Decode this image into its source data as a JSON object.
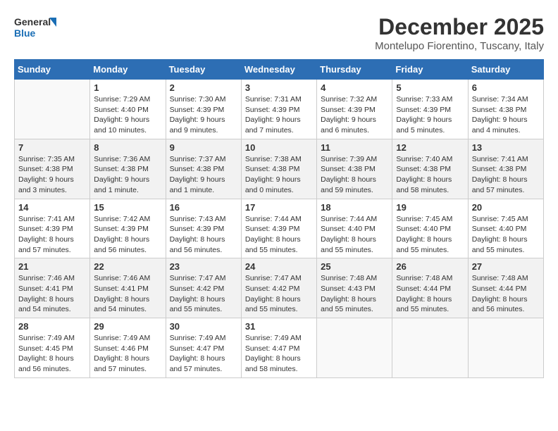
{
  "logo": {
    "line1": "General",
    "line2": "Blue"
  },
  "title": "December 2025",
  "location": "Montelupo Fiorentino, Tuscany, Italy",
  "weekdays": [
    "Sunday",
    "Monday",
    "Tuesday",
    "Wednesday",
    "Thursday",
    "Friday",
    "Saturday"
  ],
  "weeks": [
    [
      {
        "day": "",
        "empty": true
      },
      {
        "day": "1",
        "sunrise": "7:29 AM",
        "sunset": "4:40 PM",
        "daylight": "9 hours and 10 minutes."
      },
      {
        "day": "2",
        "sunrise": "7:30 AM",
        "sunset": "4:39 PM",
        "daylight": "9 hours and 9 minutes."
      },
      {
        "day": "3",
        "sunrise": "7:31 AM",
        "sunset": "4:39 PM",
        "daylight": "9 hours and 7 minutes."
      },
      {
        "day": "4",
        "sunrise": "7:32 AM",
        "sunset": "4:39 PM",
        "daylight": "9 hours and 6 minutes."
      },
      {
        "day": "5",
        "sunrise": "7:33 AM",
        "sunset": "4:39 PM",
        "daylight": "9 hours and 5 minutes."
      },
      {
        "day": "6",
        "sunrise": "7:34 AM",
        "sunset": "4:38 PM",
        "daylight": "9 hours and 4 minutes."
      }
    ],
    [
      {
        "day": "7",
        "sunrise": "7:35 AM",
        "sunset": "4:38 PM",
        "daylight": "9 hours and 3 minutes."
      },
      {
        "day": "8",
        "sunrise": "7:36 AM",
        "sunset": "4:38 PM",
        "daylight": "9 hours and 1 minute."
      },
      {
        "day": "9",
        "sunrise": "7:37 AM",
        "sunset": "4:38 PM",
        "daylight": "9 hours and 1 minute."
      },
      {
        "day": "10",
        "sunrise": "7:38 AM",
        "sunset": "4:38 PM",
        "daylight": "9 hours and 0 minutes."
      },
      {
        "day": "11",
        "sunrise": "7:39 AM",
        "sunset": "4:38 PM",
        "daylight": "8 hours and 59 minutes."
      },
      {
        "day": "12",
        "sunrise": "7:40 AM",
        "sunset": "4:38 PM",
        "daylight": "8 hours and 58 minutes."
      },
      {
        "day": "13",
        "sunrise": "7:41 AM",
        "sunset": "4:38 PM",
        "daylight": "8 hours and 57 minutes."
      }
    ],
    [
      {
        "day": "14",
        "sunrise": "7:41 AM",
        "sunset": "4:39 PM",
        "daylight": "8 hours and 57 minutes."
      },
      {
        "day": "15",
        "sunrise": "7:42 AM",
        "sunset": "4:39 PM",
        "daylight": "8 hours and 56 minutes."
      },
      {
        "day": "16",
        "sunrise": "7:43 AM",
        "sunset": "4:39 PM",
        "daylight": "8 hours and 56 minutes."
      },
      {
        "day": "17",
        "sunrise": "7:44 AM",
        "sunset": "4:39 PM",
        "daylight": "8 hours and 55 minutes."
      },
      {
        "day": "18",
        "sunrise": "7:44 AM",
        "sunset": "4:40 PM",
        "daylight": "8 hours and 55 minutes."
      },
      {
        "day": "19",
        "sunrise": "7:45 AM",
        "sunset": "4:40 PM",
        "daylight": "8 hours and 55 minutes."
      },
      {
        "day": "20",
        "sunrise": "7:45 AM",
        "sunset": "4:40 PM",
        "daylight": "8 hours and 55 minutes."
      }
    ],
    [
      {
        "day": "21",
        "sunrise": "7:46 AM",
        "sunset": "4:41 PM",
        "daylight": "8 hours and 54 minutes."
      },
      {
        "day": "22",
        "sunrise": "7:46 AM",
        "sunset": "4:41 PM",
        "daylight": "8 hours and 54 minutes."
      },
      {
        "day": "23",
        "sunrise": "7:47 AM",
        "sunset": "4:42 PM",
        "daylight": "8 hours and 55 minutes."
      },
      {
        "day": "24",
        "sunrise": "7:47 AM",
        "sunset": "4:42 PM",
        "daylight": "8 hours and 55 minutes."
      },
      {
        "day": "25",
        "sunrise": "7:48 AM",
        "sunset": "4:43 PM",
        "daylight": "8 hours and 55 minutes."
      },
      {
        "day": "26",
        "sunrise": "7:48 AM",
        "sunset": "4:44 PM",
        "daylight": "8 hours and 55 minutes."
      },
      {
        "day": "27",
        "sunrise": "7:48 AM",
        "sunset": "4:44 PM",
        "daylight": "8 hours and 56 minutes."
      }
    ],
    [
      {
        "day": "28",
        "sunrise": "7:49 AM",
        "sunset": "4:45 PM",
        "daylight": "8 hours and 56 minutes."
      },
      {
        "day": "29",
        "sunrise": "7:49 AM",
        "sunset": "4:46 PM",
        "daylight": "8 hours and 57 minutes."
      },
      {
        "day": "30",
        "sunrise": "7:49 AM",
        "sunset": "4:47 PM",
        "daylight": "8 hours and 57 minutes."
      },
      {
        "day": "31",
        "sunrise": "7:49 AM",
        "sunset": "4:47 PM",
        "daylight": "8 hours and 58 minutes."
      },
      {
        "day": "",
        "empty": true
      },
      {
        "day": "",
        "empty": true
      },
      {
        "day": "",
        "empty": true
      }
    ]
  ],
  "labels": {
    "sunrise": "Sunrise:",
    "sunset": "Sunset:",
    "daylight": "Daylight:"
  }
}
